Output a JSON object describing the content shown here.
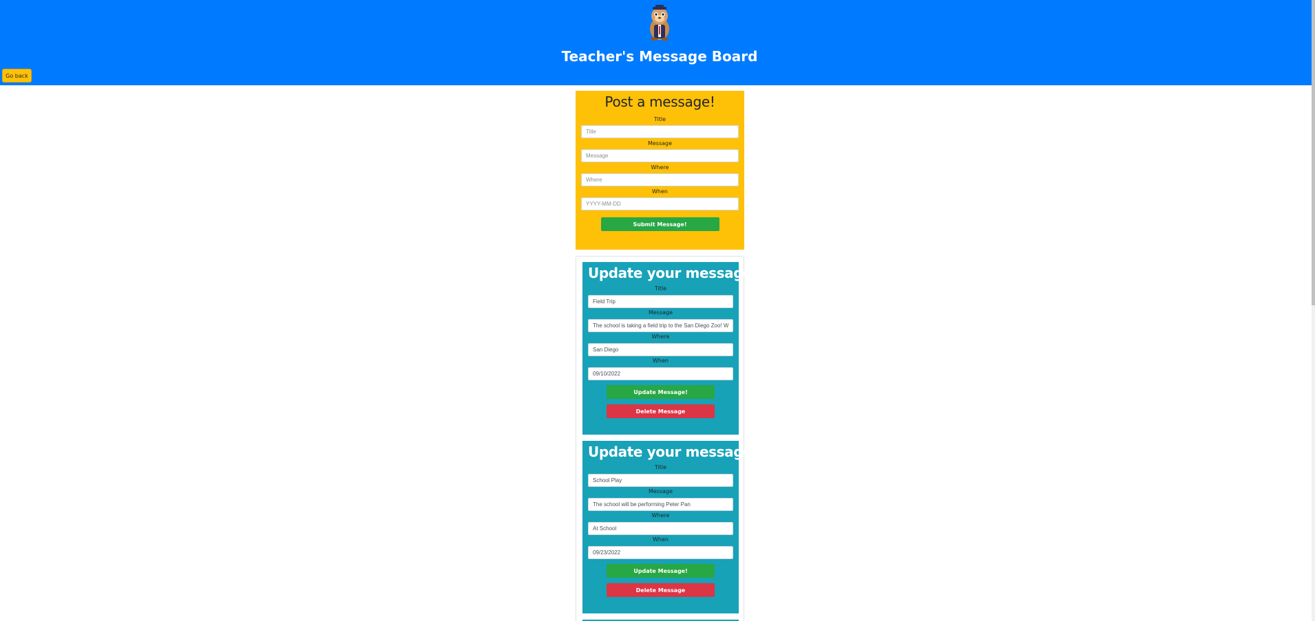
{
  "header": {
    "title": "Teacher's Message Board",
    "back_label": "Go back",
    "logo_icon": "owl-mascot-icon",
    "background": "#007bff"
  },
  "post_form": {
    "heading": "Post a message!",
    "title_label": "Title",
    "title_placeholder": "Title",
    "message_label": "Message",
    "message_placeholder": "Message",
    "where_label": "Where",
    "where_placeholder": "Where",
    "when_label": "When",
    "when_placeholder": "YYYY-MM-DD",
    "submit_label": "Submit Message!"
  },
  "messages": [
    {
      "heading": "Update your messages!",
      "title_label": "Title",
      "title_value": "Field Trip",
      "message_label": "Message",
      "message_value": "The school is taking a field trip to the San Diego Zoo! W",
      "where_label": "Where",
      "where_value": "San Diego",
      "when_label": "When",
      "when_value": "09/10/2022",
      "update_label": "Update Message!",
      "delete_label": "Delete Message"
    },
    {
      "heading": "Update your messages!",
      "title_label": "Title",
      "title_value": "School Play",
      "message_label": "Message",
      "message_value": "The school will be performing Peter Pan",
      "where_label": "Where",
      "where_value": "At School",
      "when_label": "When",
      "when_value": "09/23/2022",
      "update_label": "Update Message!",
      "delete_label": "Delete Message"
    }
  ]
}
